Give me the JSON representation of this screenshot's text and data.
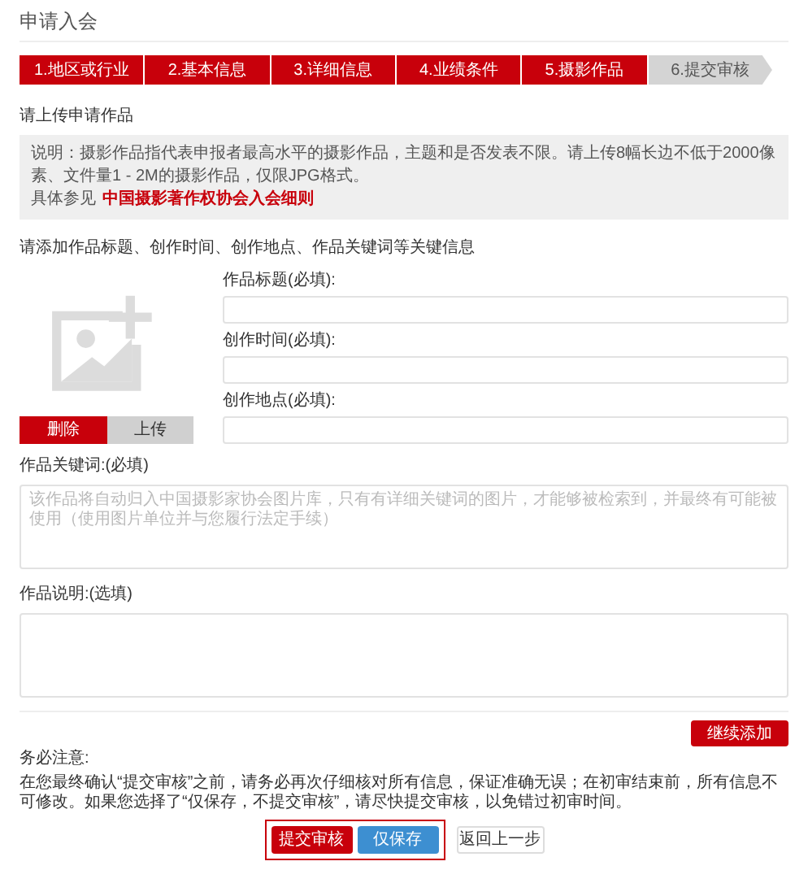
{
  "page_title": "申请入会",
  "steps": [
    {
      "label": "1.地区或行业",
      "done": true
    },
    {
      "label": "2.基本信息",
      "done": true
    },
    {
      "label": "3.详细信息",
      "done": true
    },
    {
      "label": "4.业绩条件",
      "done": true
    },
    {
      "label": "5.摄影作品",
      "done": true
    },
    {
      "label": "6.提交审核",
      "done": false
    }
  ],
  "upload_heading": "请上传申请作品",
  "notice": {
    "text": "说明：摄影作品指代表申报者最高水平的摄影作品，主题和是否发表不限。请上传8幅长边不低于2000像素、文件量1 - 2M的摄影作品，仅限JPG格式。",
    "see_also": "具体参见",
    "link": "中国摄影著作权协会入会细则"
  },
  "add_info_heading": "请添加作品标题、创作时间、创作地点、作品关键词等关键信息",
  "image_buttons": [
    {
      "label": "删除",
      "kind": "danger"
    },
    {
      "label": "上传",
      "kind": "default"
    }
  ],
  "fields": [
    {
      "label": "作品标题(必填):"
    },
    {
      "label": "创作时间(必填):"
    },
    {
      "label": "创作地点(必填):"
    }
  ],
  "keywords": {
    "label": "作品关键词:(必填)",
    "placeholder": "该作品将自动归入中国摄影家协会图片库，只有有详细关键词的图片，才能够被检索到，并最终有可能被使用（使用图片单位并与您履行法定手续）"
  },
  "description": {
    "label": "作品说明:(选填)"
  },
  "add_more_button": "继续添加",
  "warning": {
    "title": "务必注意:",
    "text": "在您最终确认“提交审核”之前，请务必再次仔细核对所有信息，保证准确无误；在初审结束前，所有信息不可修改。如果您选择了“仅保存，不提交审核”，请尽快提交审核，以免错过初审时间。"
  },
  "actions": [
    {
      "label": "提交审核",
      "kind": "danger"
    },
    {
      "label": "仅保存",
      "kind": "primary"
    },
    {
      "label": "返回上一步",
      "kind": "default"
    }
  ]
}
